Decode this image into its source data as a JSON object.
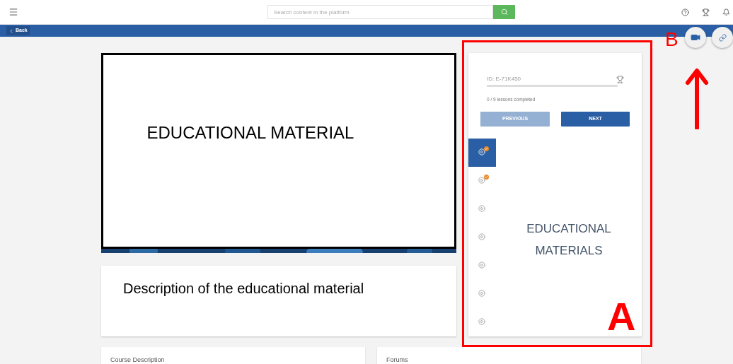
{
  "top_bar": {
    "search": {
      "placeholder": "Search content in the platform"
    }
  },
  "nav_bar": {
    "back_label": "Back"
  },
  "player": {
    "slide_title": "EDUCATIONAL MATERIAL"
  },
  "description": {
    "text": "Description of the educational material"
  },
  "lesson_panel": {
    "id_label": "ID: E-71K450",
    "progress": {
      "level": 0
    },
    "progress_text": "0 / 9 lessons completed",
    "previous_label": "PREVIOUS",
    "next_label": "NEXT",
    "content_label": "EDUCATIONAL MATERIALS",
    "lessons": [
      {
        "selected": true,
        "completed": true
      },
      {
        "selected": false,
        "completed": true
      },
      {
        "selected": false,
        "completed": false
      },
      {
        "selected": false,
        "completed": false
      },
      {
        "selected": false,
        "completed": false
      },
      {
        "selected": false,
        "completed": false
      },
      {
        "selected": false,
        "completed": false
      }
    ]
  },
  "bottom_cards": [
    {
      "title": "Course Description"
    },
    {
      "title": "Forums"
    }
  ],
  "annotations": {
    "panel_label": "A",
    "button_label": "B"
  }
}
